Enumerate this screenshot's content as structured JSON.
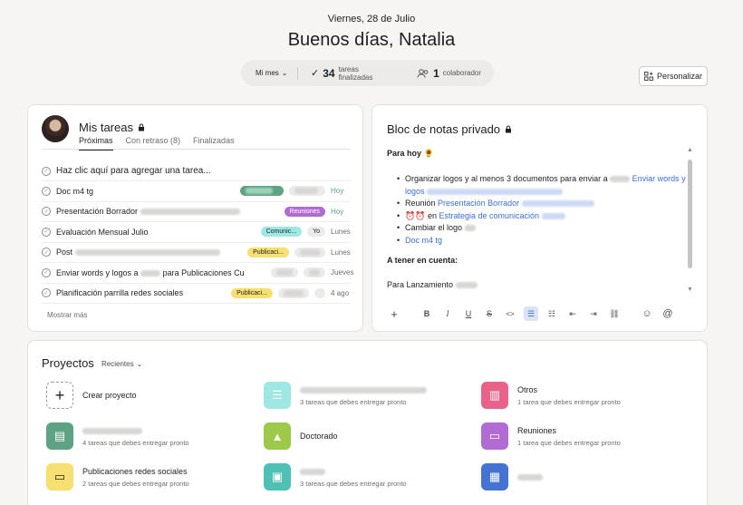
{
  "header": {
    "date": "Viernes, 28 de Julio",
    "greeting": "Buenos días, Natalia",
    "period": "Mi mes",
    "tasks_done_count": "34",
    "tasks_done_label": "tareas finalizadas",
    "collaborators_count": "1",
    "collaborators_label": "colaborador",
    "customize": "Personalizar"
  },
  "tasks": {
    "title": "Mis tareas",
    "tabs": [
      "Próximas",
      "Con retraso (8)",
      "Finalizadas"
    ],
    "add_task": "Haz clic aquí para agregar una tarea...",
    "show_more": "Mostrar más",
    "rows": [
      {
        "name": "Doc m4 tg",
        "tag": "",
        "tag_color": "#5da283",
        "due": "Hoy"
      },
      {
        "name": "Presentación Borrador",
        "tag": "Reuniones",
        "tag_color": "#b36bd4",
        "due": "Hoy"
      },
      {
        "name": "Evaluación Mensual Julio",
        "tag": "Comunic...",
        "tag_color": "#9ee7e3",
        "extra": "Yo",
        "due": "Lunes"
      },
      {
        "name": "Post",
        "tag": "Publicaci...",
        "tag_color": "#f8df72",
        "due": "Lunes"
      },
      {
        "name": "Enviar words y logos a",
        "name_b": "para Publicaciones Cu",
        "tag": "",
        "tag_color": "#5da283",
        "due": "Jueves"
      },
      {
        "name": "Planificación parrilla redes sociales",
        "tag": "Publicaci...",
        "tag_color": "#f8df72",
        "due": "4 ago"
      }
    ]
  },
  "notes": {
    "title": "Bloc de notas privado",
    "heading_today": "Para hoy 🌻",
    "items": {
      "i1_a": "Organizar logos y al menos 3 documentos para enviar a",
      "i1_link": "Enviar words y",
      "i1_b": "logos",
      "i2_a": "Reunión",
      "i2_link": "Presentación Borrador",
      "i3_emoji": "⏰⏰",
      "i3_a": "en",
      "i3_link": "Estrategia de comunicación",
      "i4": "Cambiar el logo",
      "i5_link": "Doc m4 tg"
    },
    "heading_consider": "A tener en cuenta:",
    "footer_line": "Para Lanzamiento"
  },
  "projects": {
    "title": "Proyectos",
    "filter": "Recientes",
    "create": "Crear proyecto",
    "items": [
      {
        "name": "",
        "sub": "3 tareas que debes entregar pronto",
        "color": "#9ee7e3"
      },
      {
        "name": "Otros",
        "sub": "1 tarea que debes entregar pronto",
        "color": "#e8628a"
      },
      {
        "name": "",
        "sub": "4 tareas que debes entregar pronto",
        "color": "#5da283"
      },
      {
        "name": "Doctorado",
        "sub": "",
        "color": "#9cc94a"
      },
      {
        "name": "Reuniones",
        "sub": "1 tarea que debes entregar pronto",
        "color": "#b36bd4"
      },
      {
        "name": "Publicaciones redes sociales",
        "sub": "2 tareas que debes entregar pronto",
        "color": "#f8df72"
      },
      {
        "name": "",
        "sub": "3 tareas que debes entregar pronto",
        "color": "#4ec0b4"
      },
      {
        "name": "",
        "sub": "",
        "color": "#4573d2"
      }
    ]
  }
}
